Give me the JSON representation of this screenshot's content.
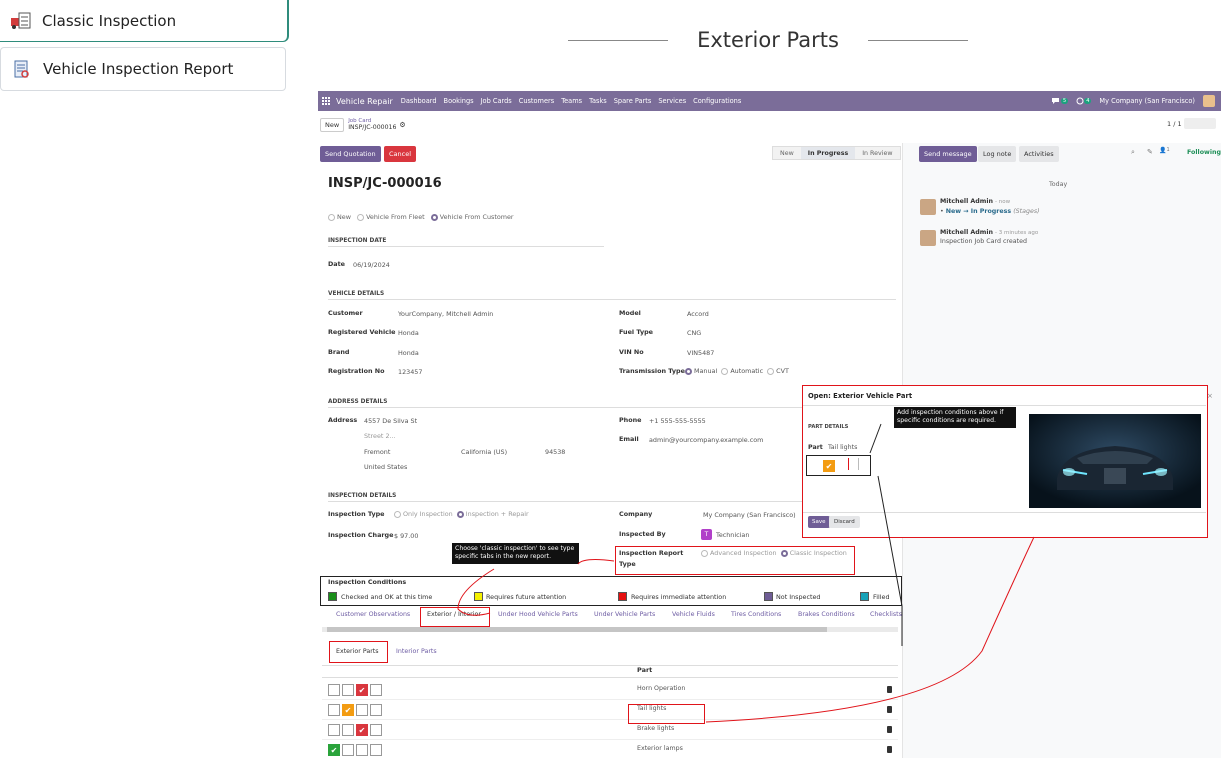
{
  "doc_tabs": [
    {
      "label": "Classic Inspection",
      "icon": "truck-checklist-icon"
    },
    {
      "label": "Vehicle Inspection Report",
      "icon": "report-icon"
    }
  ],
  "section_title": "Exterior Parts",
  "navbar": {
    "app": "Vehicle Repair",
    "menu": [
      "Dashboard",
      "Bookings",
      "Job Cards",
      "Customers",
      "Teams",
      "Tasks",
      "Spare Parts",
      "Services",
      "Configurations"
    ],
    "chat_count": "5",
    "activity_count": "4",
    "company": "My Company (San Francisco)"
  },
  "breadcrumb": {
    "new": "New",
    "parent": "Job Card",
    "record": "INSP/JC-000016",
    "pager": "1 / 1"
  },
  "actions": {
    "send_quotation": "Send Quotation",
    "cancel": "Cancel"
  },
  "status": {
    "stages": [
      "New",
      "In Progress",
      "In Review"
    ],
    "current": "In Progress"
  },
  "chatter_actions": {
    "send_message": "Send message",
    "log_note": "Log note",
    "activities": "Activities",
    "followers": "1",
    "following": "Following"
  },
  "record": {
    "title": "INSP/JC-000016",
    "source_options": [
      "New",
      "Vehicle From Fleet",
      "Vehicle From Customer"
    ],
    "inspection_date_head": "INSPECTION DATE",
    "date_label": "Date",
    "date": "06/19/2024",
    "vehicle_head": "VEHICLE DETAILS",
    "customer_label": "Customer",
    "customer": "YourCompany, Mitchell Admin",
    "reg_vehicle_label": "Registered Vehicle",
    "reg_vehicle": "Honda",
    "brand_label": "Brand",
    "brand": "Honda",
    "reg_no_label": "Registration No",
    "reg_no": "123457",
    "model_label": "Model",
    "model": "Accord",
    "fuel_label": "Fuel Type",
    "fuel": "CNG",
    "vin_label": "VIN No",
    "vin": "VIN5487",
    "transmission_label": "Transmission Type",
    "transmission_options": [
      "Manual",
      "Automatic",
      "CVT"
    ],
    "address_head": "ADDRESS DETAILS",
    "address_label": "Address",
    "street": "4557 De Silva St",
    "street2": "Street 2...",
    "city": "Fremont",
    "state": "California (US)",
    "zip": "94538",
    "country": "United States",
    "phone_label": "Phone",
    "phone": "+1 555-555-5555",
    "email_label": "Email",
    "email": "admin@yourcompany.example.com",
    "insp_head": "INSPECTION DETAILS",
    "insp_type_label": "Inspection Type",
    "insp_type_options": [
      "Only Inspection",
      "Inspection + Repair"
    ],
    "insp_charge_label": "Inspection Charge",
    "insp_charge": "$ 97.00",
    "company_label": "Company",
    "company": "My Company (San Francisco)",
    "insp_by_label": "Inspected By",
    "insp_by": "Technician",
    "insp_by_initial": "T",
    "report_type_label_1": "Inspection Report",
    "report_type_label_2": "Type",
    "report_type_options": [
      "Advanced Inspection",
      "Classic Inspection"
    ]
  },
  "conditions": {
    "title": "Inspection Conditions",
    "items": [
      {
        "label": "Checked and OK at this time",
        "color": "#1a8f1a"
      },
      {
        "label": "Requires future attention",
        "color": "#f5f000"
      },
      {
        "label": "Requires immediate attention",
        "color": "#e61010"
      },
      {
        "label": "Not Inspected",
        "color": "#6f5d96"
      },
      {
        "label": "Filled",
        "color": "#17a2b8"
      }
    ]
  },
  "tabs": [
    "Customer Observations",
    "Exterior / Interior",
    "Under Hood Vehicle Parts",
    "Under Vehicle Parts",
    "Vehicle Fluids",
    "Tires Conditions",
    "Brakes Conditions",
    "Checklists"
  ],
  "subtabs": [
    "Exterior Parts",
    "Interior Parts"
  ],
  "parts_header": "Part",
  "parts": [
    {
      "name": "Horn Operation",
      "state": "red"
    },
    {
      "name": "Tail lights",
      "state": "yellow"
    },
    {
      "name": "Brake lights",
      "state": "red"
    },
    {
      "name": "Exterior lamps",
      "state": "green"
    }
  ],
  "chatter": {
    "today": "Today",
    "messages": [
      {
        "author": "Mitchell Admin",
        "time": "- now",
        "line": "New → In Progress",
        "extra": "(Stages)"
      },
      {
        "author": "Mitchell Admin",
        "time": "- 3 minutes ago",
        "line": "Inspection Job Card created",
        "extra": ""
      }
    ]
  },
  "tooltips": {
    "classic": "Choose 'classic inspection' to see type specific tabs in the new report.",
    "conditions": "Add inspection conditions above if specific conditions are required."
  },
  "modal": {
    "title": "Open: Exterior Vehicle Part",
    "section": "PART DETAILS",
    "part_label": "Part",
    "part_value": "Tail lights",
    "save": "Save",
    "discard": "Discard"
  }
}
